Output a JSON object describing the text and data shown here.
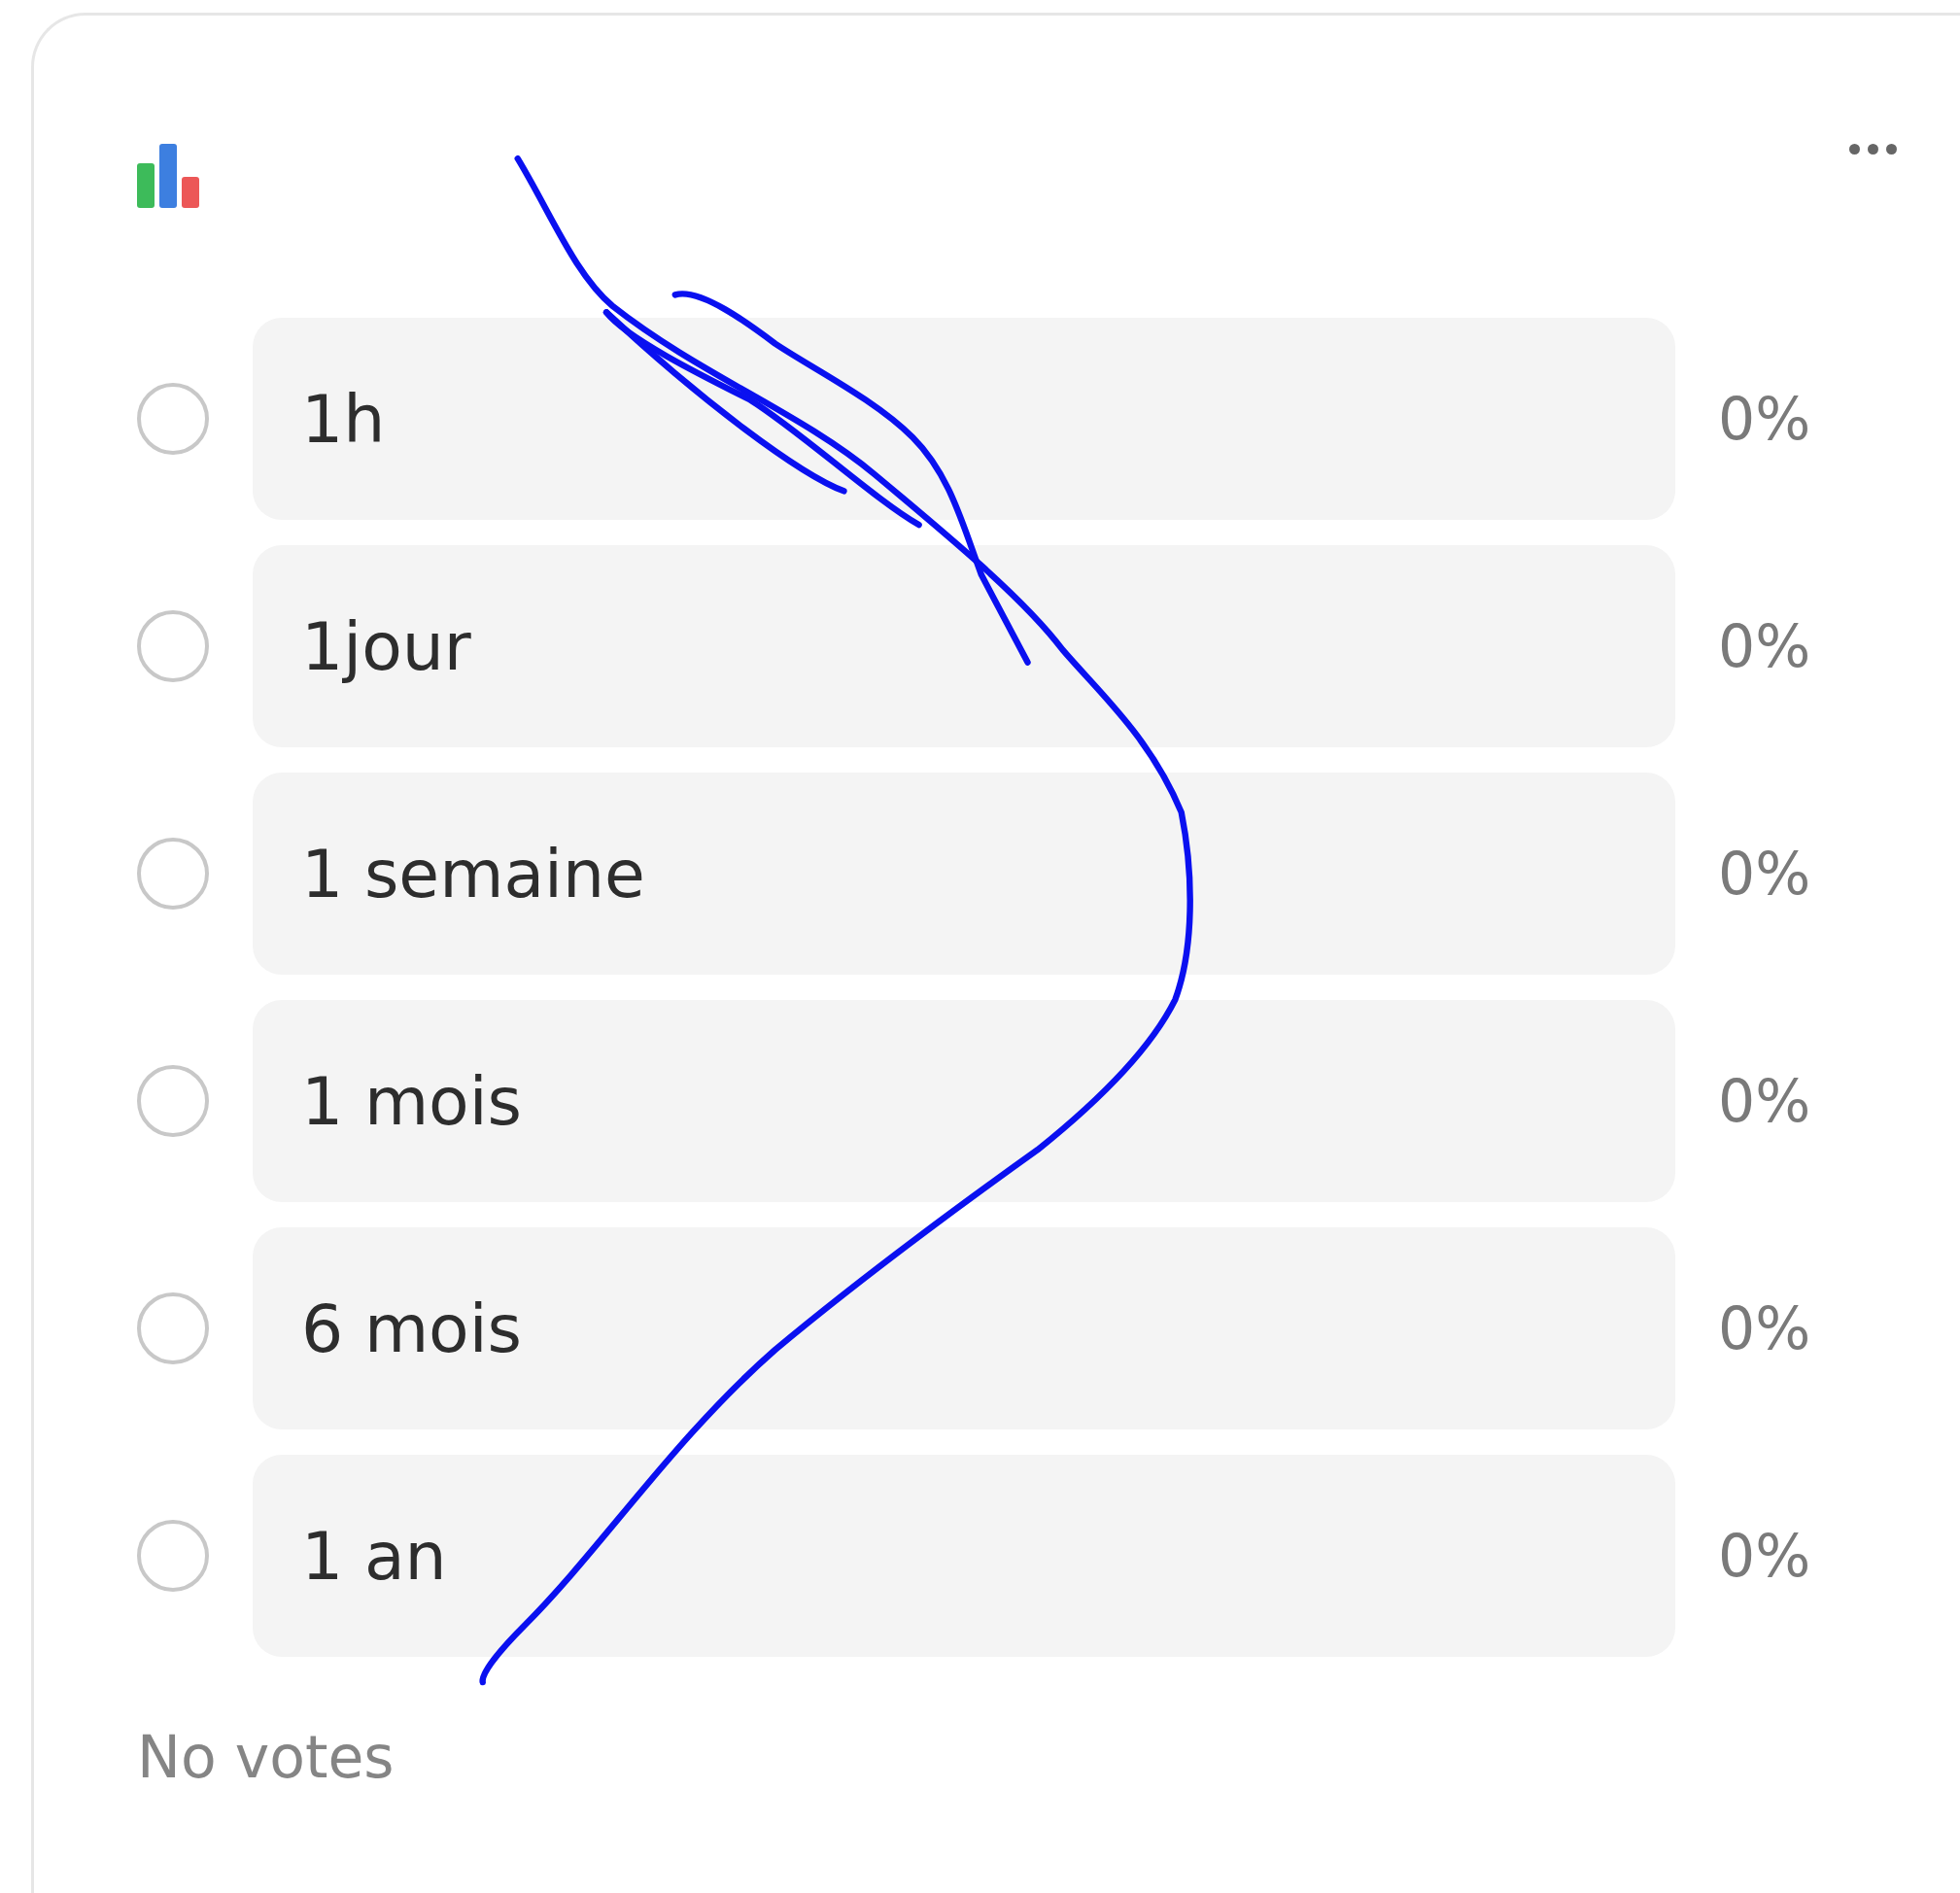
{
  "options": [
    {
      "label": "1h",
      "percent": "0%",
      "selected": false
    },
    {
      "label": "1jour",
      "percent": "0%",
      "selected": false
    },
    {
      "label": "1 semaine",
      "percent": "0%",
      "selected": false
    },
    {
      "label": "1 mois",
      "percent": "0%",
      "selected": false
    },
    {
      "label": "6 mois",
      "percent": "0%",
      "selected": false
    },
    {
      "label": "1 an",
      "percent": "0%",
      "selected": false
    }
  ],
  "summary": "No votes"
}
